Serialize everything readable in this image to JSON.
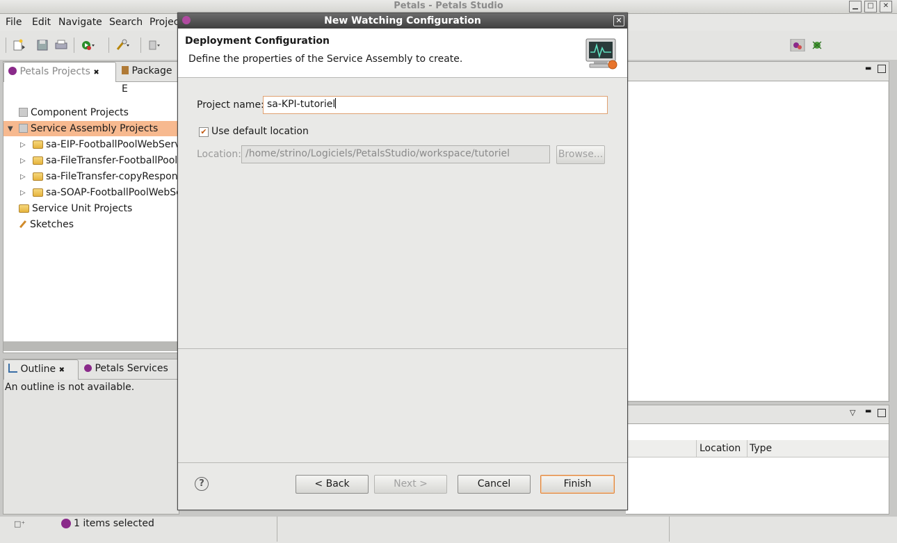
{
  "window": {
    "title": "Petals - Petals Studio"
  },
  "menu": [
    "File",
    "Edit",
    "Navigate",
    "Search",
    "Projec"
  ],
  "project_panel": {
    "tabs": [
      {
        "label": "Petals Projects",
        "close": "✖"
      },
      {
        "label": "Package E"
      }
    ],
    "tree": [
      {
        "label": "Component Projects"
      },
      {
        "label": "Service Assembly Projects",
        "expand": "▼"
      },
      {
        "label": "sa-EIP-FootballPoolWebServic",
        "expand": "▷"
      },
      {
        "label": "sa-FileTransfer-FootballPoolW",
        "expand": "▷"
      },
      {
        "label": "sa-FileTransfer-copyResponse",
        "expand": "▷"
      },
      {
        "label": "sa-SOAP-FootballPoolWebSer",
        "expand": "▷"
      },
      {
        "label": "Service Unit Projects"
      },
      {
        "label": "Sketches"
      }
    ]
  },
  "outline_panel": {
    "tabs": [
      {
        "label": "Outline",
        "close": "✖"
      },
      {
        "label": "Petals Services"
      }
    ],
    "message": "An outline is not available."
  },
  "bottom_table": {
    "columns": [
      "Location",
      "Type"
    ]
  },
  "status": {
    "text": "1 items selected"
  },
  "dialog": {
    "title": "New Watching Configuration",
    "close": "✕",
    "header_title": "Deployment Configuration",
    "header_desc": "Define the properties of the Service Assembly to create.",
    "project_name_label": "Project name:",
    "project_name_value": "sa-KPI-tutoriel",
    "use_default_label": "Use default location",
    "use_default_checked": "✔",
    "location_label": "Location:",
    "location_value": "/home/strino/Logiciels/PetalsStudio/workspace/tutoriel",
    "browse_label": "Browse...",
    "help": "?",
    "back_label": "< Back",
    "next_label": "Next >",
    "cancel_label": "Cancel",
    "finish_label": "Finish"
  },
  "colors": {
    "selection": "#f7b98f",
    "accent": "#e0853c"
  }
}
